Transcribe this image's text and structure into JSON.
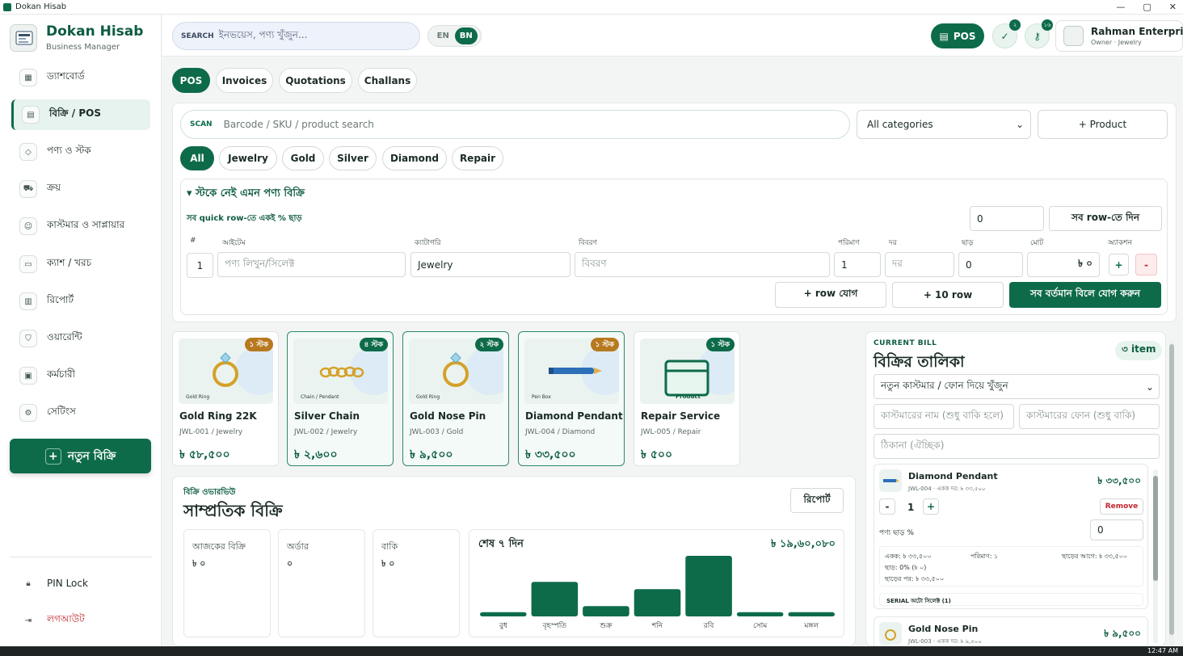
{
  "window": {
    "title": "Dokan Hisab",
    "controls": [
      "—",
      "▢",
      "✕"
    ]
  },
  "brand": {
    "name": "Dokan Hisab",
    "subtitle": "Business Manager"
  },
  "nav": [
    {
      "label": "ড্যাশবোর্ড",
      "icon": "grid-icon"
    },
    {
      "label": "বিক্রি / POS",
      "icon": "receipt-icon",
      "active": true
    },
    {
      "label": "পণ্য ও স্টক",
      "icon": "box-icon"
    },
    {
      "label": "ক্রয়",
      "icon": "truck-icon"
    },
    {
      "label": "কাস্টমার ও সাপ্লায়ার",
      "icon": "users-icon"
    },
    {
      "label": "ক্যাশ / খরচ",
      "icon": "wallet-icon"
    },
    {
      "label": "রিপোর্ট",
      "icon": "bar-chart-icon"
    },
    {
      "label": "ওয়ারেন্টি",
      "icon": "shield-icon"
    },
    {
      "label": "কর্মচারী",
      "icon": "calendar-icon"
    },
    {
      "label": "সেটিংস",
      "icon": "gear-icon"
    }
  ],
  "new_sale": "নতুন বিক্রি",
  "pin_lock": "PIN Lock",
  "logout": "লগআউট",
  "search": {
    "label": "SEARCH",
    "placeholder": "ইনভয়েস, পণ্য খুঁজুন..."
  },
  "lang": {
    "en": "EN",
    "bn": "BN",
    "active": "BN"
  },
  "top": {
    "pos": "POS",
    "warranty_badge": "২",
    "key_badge": "১৬"
  },
  "profile": {
    "name": "Rahman Enterprise",
    "sub": "Owner · Jewelry"
  },
  "tabs": [
    "POS",
    "Invoices",
    "Quotations",
    "Challans"
  ],
  "scan": {
    "label": "SCAN",
    "placeholder": "Barcode / SKU / product search"
  },
  "category_select": "All categories",
  "add_product": "+ Product",
  "chips": [
    "All",
    "Jewelry",
    "Gold",
    "Silver",
    "Diamond",
    "Repair"
  ],
  "quick": {
    "title": "▾ স্টকে নেই এমন পণ্য বিক্রি",
    "subtitle": "সব quick row-তে একই % ছাড়",
    "discount_all": "0",
    "apply_all": "সব row-তে দিন",
    "headers": [
      "#",
      "আইটেম",
      "ক্যাটাগরি",
      "বিবরণ",
      "পরিমাণ",
      "দর",
      "ছাড়",
      "মোট",
      "অ্যাকশন"
    ],
    "row": {
      "no": "1",
      "item_ph": "পণ্য লিখুন/সিলেক্ট",
      "category": "Jewelry",
      "desc_ph": "বিবরণ",
      "qty": "1",
      "rate_ph": "দর",
      "discount": "0",
      "total": "৳ ০"
    },
    "add_row": "+ row যোগ",
    "add_10": "+ 10 row",
    "add_to_bill": "সব বর্তমান বিলে যোগ করুন"
  },
  "products": [
    {
      "name": "Gold Ring 22K",
      "sku": "JWL-001 / Jewelry",
      "price": "৳ ৫৮,৫০০",
      "stock": "১ স্টক",
      "caption": "Gold Ring",
      "selected": false,
      "stock_color": "#b7791f"
    },
    {
      "name": "Silver Chain",
      "sku": "JWL-002 / Jewelry",
      "price": "৳ ২,৬০০",
      "stock": "৪ স্টক",
      "caption": "Chain / Pendant",
      "selected": true,
      "stock_color": "#0e6b4a"
    },
    {
      "name": "Gold Nose Pin",
      "sku": "JWL-003 / Gold",
      "price": "৳ ৯,৫০০",
      "stock": "২ স্টক",
      "caption": "Gold Ring",
      "selected": true,
      "stock_color": "#0e6b4a"
    },
    {
      "name": "Diamond Pendant",
      "sku": "JWL-004 / Diamond",
      "price": "৳ ৩৩,৫০০",
      "stock": "১ স্টক",
      "caption": "Pen Box",
      "selected": true,
      "stock_color": "#b7791f"
    },
    {
      "name": "Repair Service",
      "sku": "JWL-005 / Repair",
      "price": "৳ ৫০০",
      "stock": "১ স্টক",
      "caption": "Product",
      "selected": false,
      "stock_color": "#0e6b4a"
    }
  ],
  "overview": {
    "kicker": "বিক্রি ওভারভিউ",
    "title": "সাম্প্রতিক বিক্রি",
    "report_btn": "রিপোর্ট",
    "stats": [
      {
        "label": "আজকের বিক্রি",
        "value": "৳ ০"
      },
      {
        "label": "অর্ডার",
        "value": "০"
      },
      {
        "label": "বাকি",
        "value": "৳ ০"
      }
    ]
  },
  "chart_data": {
    "type": "bar",
    "title": "শেষ ৭ দিন",
    "total_label": "৳ ১৯,৬০,০৮০",
    "categories": [
      "বুধ",
      "বৃহস্পতি",
      "শুক্র",
      "শনি",
      "রবি",
      "সোম",
      "মঙ্গল"
    ],
    "values": [
      0.07,
      0.57,
      0.17,
      0.45,
      1.0,
      0.07,
      0.07
    ],
    "color": "#0e6b4a"
  },
  "bill": {
    "kicker": "CURRENT BILL",
    "title": "বিক্রির তালিকা",
    "count": "৩ item",
    "customer_select": "নতুন কাস্টমার / ফোন দিয়ে খুঁজুন",
    "name_ph": "কাস্টমারের নাম (শুধু বাকি হলে)",
    "phone_ph": "কাস্টমারের ফোন (শুধু বাকি)",
    "address_ph": "ঠিকানা (ঐচ্ছিক)",
    "items": [
      {
        "name": "Diamond Pendant",
        "meta": "JWL-004 · একক দর: ৳ ৩৩,৫০০",
        "price": "৳ ৩৩,৫০০",
        "qty": "1",
        "remove": "Remove",
        "discount_label": "পণ্য ছাড় %",
        "discount": "0",
        "unit": "একক: ৳ ৩৩,৫০০",
        "qty_text": "পরিমাণ: ১",
        "before": "ছাড়ের আগে: ৳ ৩৩,৫০০",
        "disc_text": "ছাড়: 0% (৳ ০)",
        "after": "ছাড়ের পর: ৳ ৩৩,৫০০",
        "serial": "SERIAL অটো সিলেক্ট (1)"
      },
      {
        "name": "Gold Nose Pin",
        "meta": "JWL-003 · একক দর: ৳ ৯,৫০০",
        "price": "৳ ৯,৫০০"
      }
    ]
  },
  "clock": "12:47 AM"
}
